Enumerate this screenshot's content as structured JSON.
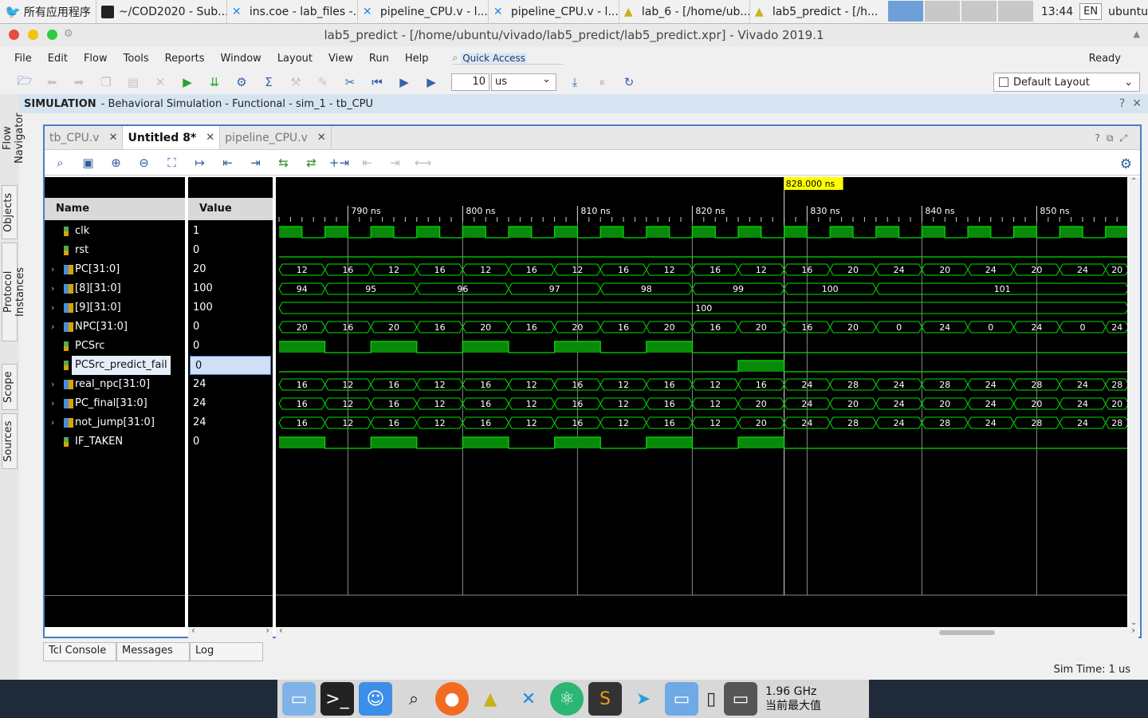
{
  "taskbar": {
    "start_label": "所有应用程序",
    "tasks": [
      "~/COD2020 - Sub...",
      "ins.coe - lab_files -...",
      "pipeline_CPU.v - l...",
      "pipeline_CPU.v - l...",
      "lab_6 - [/home/ub...",
      "lab5_predict - [/h..."
    ],
    "clock": "13:44",
    "lang": "EN",
    "user": "ubuntu"
  },
  "window": {
    "title": "lab5_predict - [/home/ubuntu/vivado/lab5_predict/lab5_predict.xpr] - Vivado 2019.1"
  },
  "menu": {
    "items": [
      "File",
      "Edit",
      "Flow",
      "Tools",
      "Reports",
      "Window",
      "Layout",
      "View",
      "Run",
      "Help"
    ],
    "quick_access": "Quick Access",
    "status": "Ready"
  },
  "toolbar": {
    "run_value": "10",
    "run_unit": "us",
    "layout": "Default Layout"
  },
  "sim": {
    "label": "SIMULATION",
    "desc": "- Behavioral Simulation - Functional - sim_1 - tb_CPU"
  },
  "side_tabs": [
    "Flow Navigator",
    "Objects",
    "Protocol Instances",
    "Scope",
    "Sources"
  ],
  "editor_tabs": [
    {
      "label": "tb_CPU.v",
      "active": false
    },
    {
      "label": "Untitled 8*",
      "active": true
    },
    {
      "label": "pipeline_CPU.v",
      "active": false
    }
  ],
  "wave": {
    "name_header": "Name",
    "value_header": "Value",
    "cursor_label": "828.000 ns",
    "time_start": 784,
    "time_end": 858,
    "cursor_time": 828,
    "ticks": [
      {
        "t": 790,
        "label": "790 ns"
      },
      {
        "t": 800,
        "label": "800 ns"
      },
      {
        "t": 810,
        "label": "810 ns"
      },
      {
        "t": 820,
        "label": "820 ns"
      },
      {
        "t": 830,
        "label": "830 ns"
      },
      {
        "t": 840,
        "label": "840 ns"
      },
      {
        "t": 850,
        "label": "850 ns"
      }
    ],
    "signals": [
      {
        "name": "clk",
        "value": "1",
        "type": "bit",
        "expandable": false
      },
      {
        "name": "rst",
        "value": "0",
        "type": "bit",
        "expandable": false
      },
      {
        "name": "PC[31:0]",
        "value": "20",
        "type": "bus",
        "expandable": true
      },
      {
        "name": "[8][31:0]",
        "value": "100",
        "type": "bus",
        "expandable": true
      },
      {
        "name": "[9][31:0]",
        "value": "100",
        "type": "bus",
        "expandable": true
      },
      {
        "name": "NPC[31:0]",
        "value": "0",
        "type": "bus",
        "expandable": true
      },
      {
        "name": "PCSrc",
        "value": "0",
        "type": "bit",
        "expandable": false
      },
      {
        "name": "PCSrc_predict_fail",
        "value": "0",
        "type": "bit",
        "expandable": false,
        "selected": true
      },
      {
        "name": "real_npc[31:0]",
        "value": "24",
        "type": "bus",
        "expandable": true
      },
      {
        "name": "PC_final[31:0]",
        "value": "24",
        "type": "bus",
        "expandable": true
      },
      {
        "name": "not_jump[31:0]",
        "value": "24",
        "type": "bus",
        "expandable": true
      },
      {
        "name": "IF_TAKEN",
        "value": "0",
        "type": "bit",
        "expandable": false
      }
    ],
    "traces": {
      "clk": {
        "period": 4,
        "high_phase": 0
      },
      "rst": [
        [
          784,
          0
        ]
      ],
      "PC": [
        "12",
        "16",
        "12",
        "16",
        "12",
        "16",
        "12",
        "16",
        "12",
        "16",
        "12",
        "16",
        "20",
        "24",
        "20",
        "24",
        "20",
        "24",
        "20",
        "24",
        "20",
        "24"
      ],
      "reg8": [
        [
          784,
          "94"
        ],
        [
          788,
          "95"
        ],
        [
          796,
          "96"
        ],
        [
          804,
          "97"
        ],
        [
          812,
          "98"
        ],
        [
          820,
          "99"
        ],
        [
          828,
          "100"
        ],
        [
          836,
          "101"
        ]
      ],
      "reg9": "100",
      "NPC": [
        "20",
        "16",
        "20",
        "16",
        "20",
        "16",
        "20",
        "16",
        "20",
        "16",
        "20",
        "16",
        "20",
        "0",
        "24",
        "0",
        "24",
        "0",
        "24",
        "0",
        "24",
        "0",
        "24"
      ],
      "PCSrc": [
        [
          784,
          1
        ],
        [
          788,
          0
        ],
        [
          792,
          1
        ],
        [
          796,
          0
        ],
        [
          800,
          1
        ],
        [
          804,
          0
        ],
        [
          808,
          1
        ],
        [
          812,
          0
        ],
        [
          816,
          1
        ],
        [
          820,
          0
        ]
      ],
      "PCSrc_predict_fail": [
        [
          784,
          0
        ],
        [
          824,
          1
        ],
        [
          828,
          0
        ]
      ],
      "real_npc": [
        "16",
        "12",
        "16",
        "12",
        "16",
        "12",
        "16",
        "12",
        "16",
        "12",
        "16",
        "24",
        "28",
        "24",
        "28",
        "24",
        "28",
        "24",
        "28"
      ],
      "PC_final": [
        "16",
        "12",
        "16",
        "12",
        "16",
        "12",
        "16",
        "12",
        "16",
        "12",
        "20",
        "24",
        "20",
        "24",
        "20",
        "24",
        "20",
        "24",
        "20"
      ],
      "not_jump": [
        "16",
        "12",
        "16",
        "12",
        "16",
        "12",
        "16",
        "12",
        "16",
        "12",
        "20",
        "24",
        "28",
        "24",
        "28",
        "24",
        "28",
        "24",
        "28"
      ],
      "IF_TAKEN": [
        [
          784,
          1
        ],
        [
          788,
          0
        ],
        [
          792,
          1
        ],
        [
          796,
          0
        ],
        [
          800,
          1
        ],
        [
          804,
          0
        ],
        [
          808,
          1
        ],
        [
          812,
          0
        ],
        [
          816,
          1
        ],
        [
          820,
          0
        ],
        [
          824,
          1
        ],
        [
          828,
          0
        ]
      ]
    }
  },
  "bottom_tabs": [
    "Tcl Console",
    "Messages",
    "Log"
  ],
  "sim_time": "Sim Time: 1 us",
  "cpu": {
    "freq": "1.96 GHz",
    "label": "当前最大值"
  },
  "colors": {
    "wave": "#00e000",
    "background": "#000000",
    "cursor_label_bg": "#ffff00",
    "accent": "#4a7ec4"
  }
}
